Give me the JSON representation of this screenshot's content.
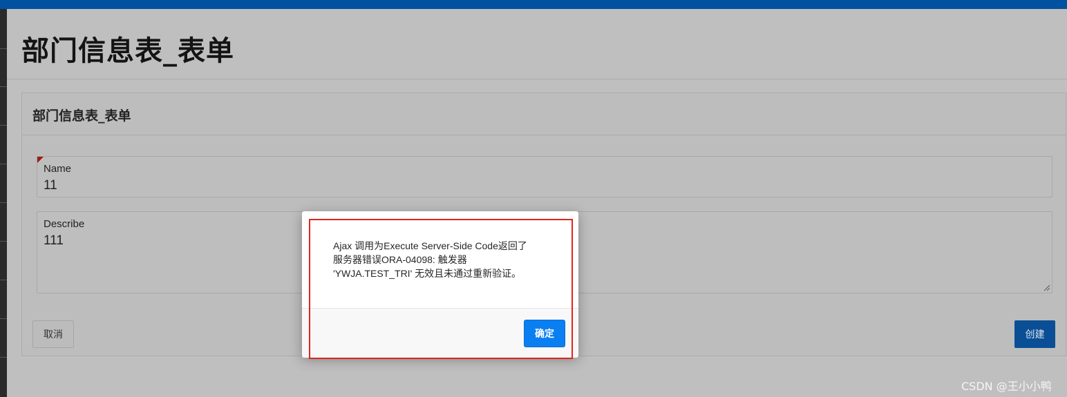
{
  "page": {
    "title": "部门信息表_表单"
  },
  "region": {
    "title": "部门信息表_表单"
  },
  "form": {
    "name": {
      "label": "Name",
      "value": "11"
    },
    "describe": {
      "label": "Describe",
      "value": "111"
    }
  },
  "buttons": {
    "cancel": "取消",
    "create": "创建"
  },
  "dialog": {
    "message_lines": [
      "Ajax 调用为Execute Server-Side Code返回了",
      "服务器错误ORA-04098: 触发器",
      "'YWJA.TEST_TRI' 无效且未通过重新验证。"
    ],
    "ok_label": "确定"
  },
  "watermark": "CSDN @王小小鸭",
  "colors": {
    "header_bar": "#0051a0",
    "create_button": "#0a4f95",
    "ok_button": "#0a7ff2",
    "highlight": "#e0231b",
    "required_marker": "#9c1b14"
  }
}
